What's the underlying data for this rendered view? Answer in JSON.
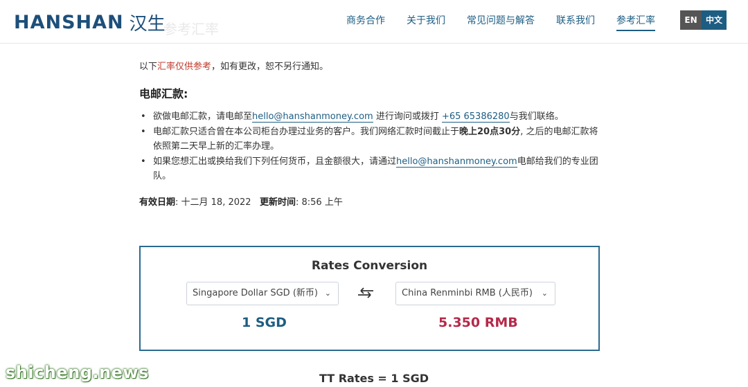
{
  "header": {
    "logo_en": "HANSHAN",
    "logo_cn": "汉生",
    "ghost_title": "参考汇率",
    "nav": [
      "商务合作",
      "关于我们",
      "常见问题与解答",
      "联系我们",
      "参考汇率"
    ],
    "lang_en": "EN",
    "lang_zh": "中文"
  },
  "notice": {
    "prefix": "以下",
    "highlight": "汇率仅供参考",
    "suffix": "，如有更改，恕不另行通知。"
  },
  "section_title": "电邮汇款:",
  "bullets": {
    "b1_a": "欲做电邮汇款，请电邮至",
    "b1_email": "hello@hanshanmoney.com",
    "b1_b": " 进行询问或拨打 ",
    "b1_phone": "+65 65386280",
    "b1_c": "与我们联络。",
    "b2_a": "电邮汇款只适合曾在本公司柜台办理过业务的客户。我们网络汇款时间截止于",
    "b2_bold": "晚上20点30分",
    "b2_b": ", 之后的电邮汇款将依照第二天早上新的汇率办理。",
    "b3_a": "如果您想汇出或换给我们下列任何货币，且金额很大，请通过",
    "b3_email": "hello@hanshanmoney.com",
    "b3_b": "电邮给我们的专业团队。"
  },
  "effective": {
    "date_label": "有效日期",
    "date_value": ": 十二月 18, 2022",
    "time_label": "更新时间",
    "time_value": ": 8:56 上午"
  },
  "converter": {
    "title": "Rates Conversion",
    "from_currency": "Singapore Dollar SGD (新币)",
    "to_currency": "China Renminbi RMB (人民币)",
    "from_amount": "1 SGD",
    "to_amount": "5.350 RMB",
    "swap_icon": "swap-arrows-icon"
  },
  "tt_rates": "TT Rates = 1 SGD",
  "watermark": "shicheng.news",
  "colors": {
    "brand": "#1d4f7a",
    "link": "#1d5d82",
    "accent_red": "#b5294a",
    "lang_active": "#1d5d82"
  }
}
